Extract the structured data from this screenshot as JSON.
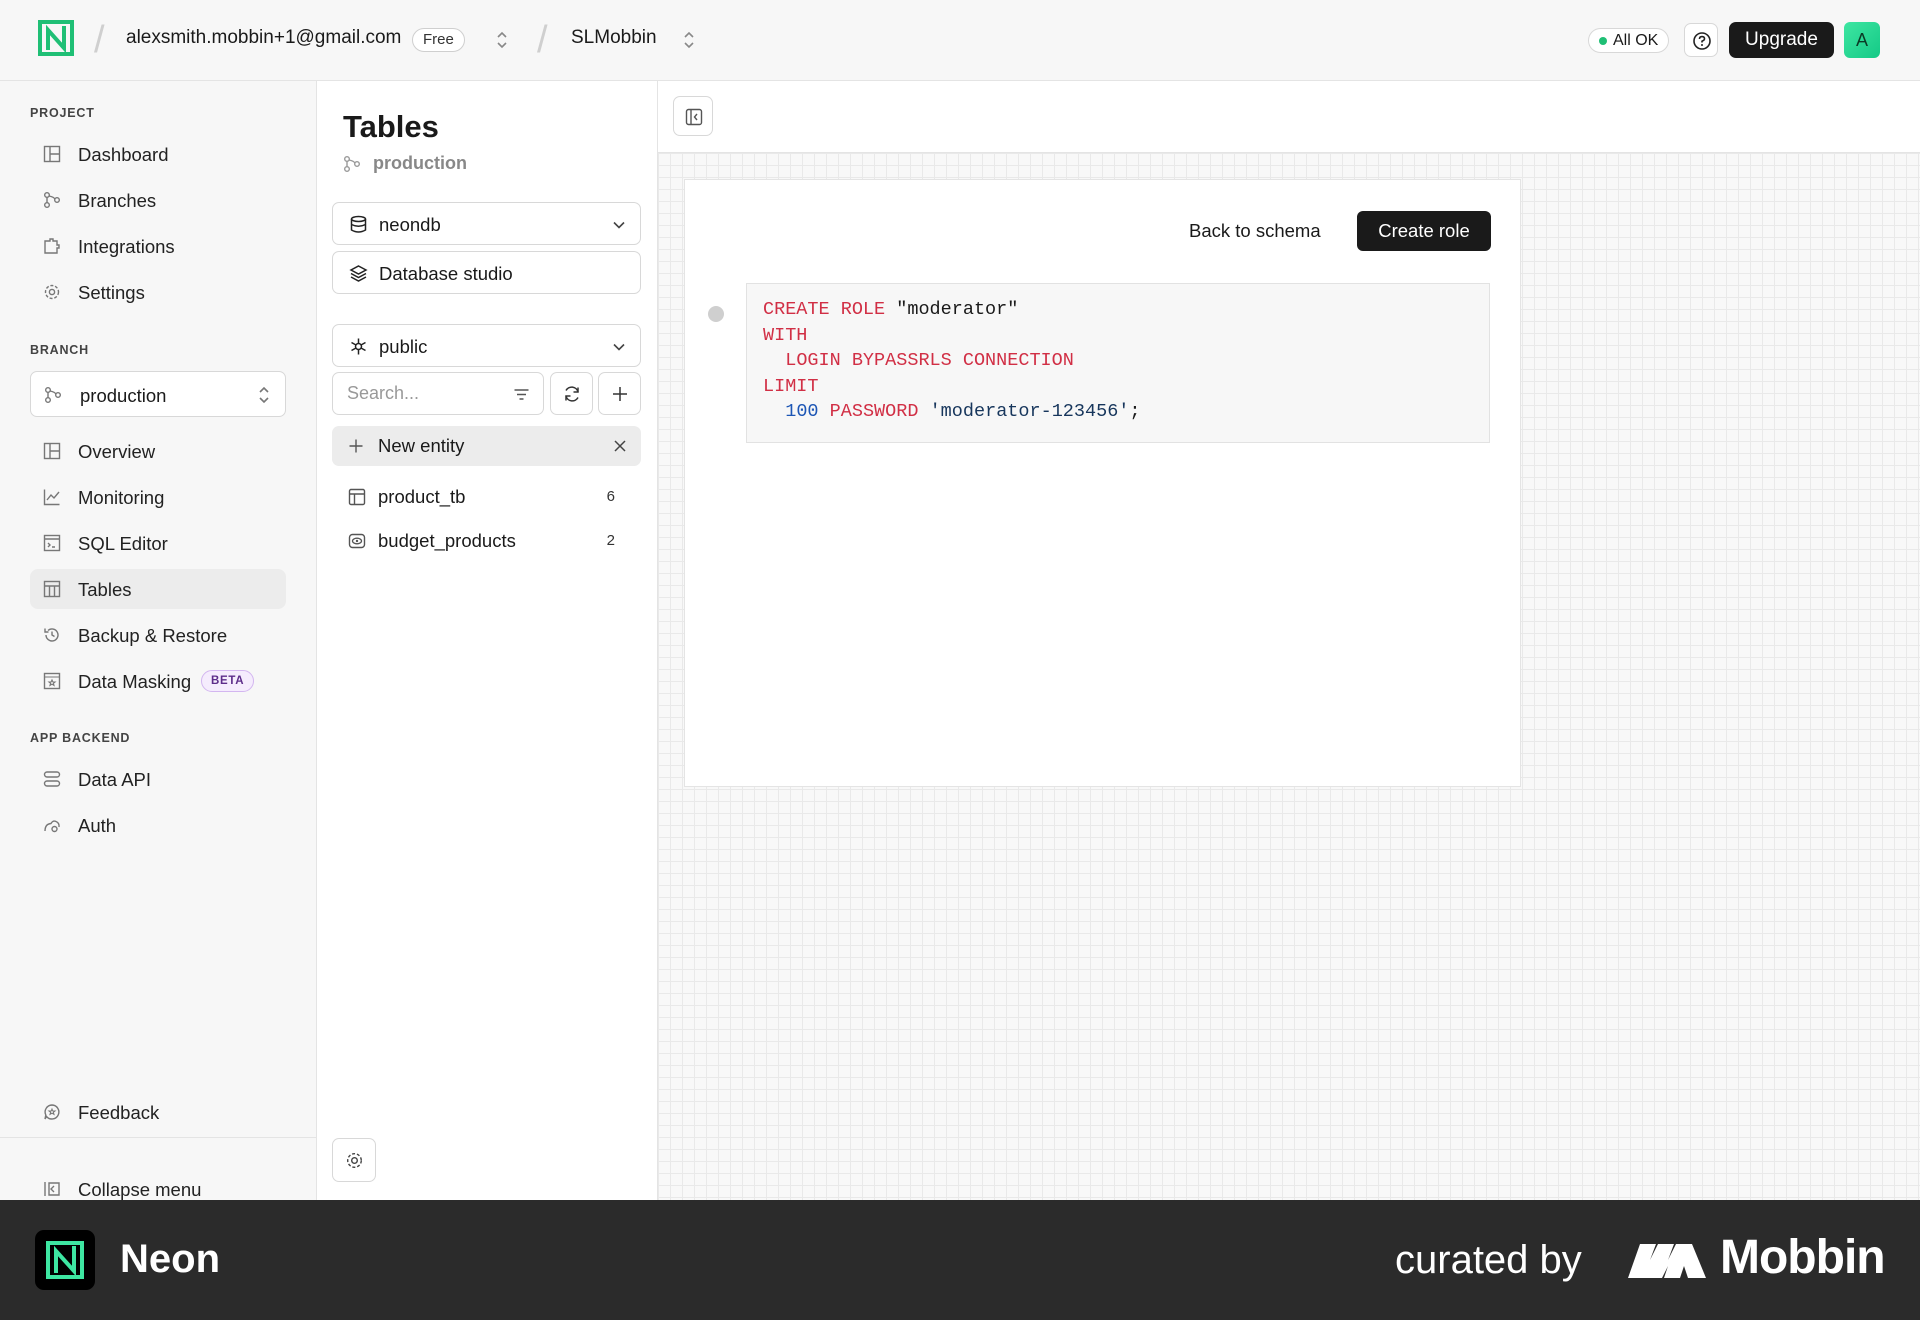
{
  "topbar": {
    "account": "alexsmith.mobbin+1@gmail.com",
    "plan": "Free",
    "project": "SLMobbin",
    "status": "All OK",
    "upgrade": "Upgrade",
    "avatar": "A"
  },
  "sidebar": {
    "project_heading": "PROJECT",
    "project_items": [
      {
        "label": "Dashboard",
        "icon": "dashboard-icon"
      },
      {
        "label": "Branches",
        "icon": "branches-icon"
      },
      {
        "label": "Integrations",
        "icon": "integrations-icon"
      },
      {
        "label": "Settings",
        "icon": "settings-icon"
      }
    ],
    "branch_heading": "BRANCH",
    "branch_selected": "production",
    "branch_items": [
      {
        "label": "Overview",
        "icon": "overview-icon"
      },
      {
        "label": "Monitoring",
        "icon": "monitoring-icon"
      },
      {
        "label": "SQL Editor",
        "icon": "sql-editor-icon"
      },
      {
        "label": "Tables",
        "icon": "tables-icon",
        "active": true
      },
      {
        "label": "Backup & Restore",
        "icon": "backup-icon"
      },
      {
        "label": "Data Masking",
        "icon": "data-masking-icon",
        "badge": "BETA"
      }
    ],
    "backend_heading": "APP BACKEND",
    "backend_items": [
      {
        "label": "Data API",
        "icon": "data-api-icon"
      },
      {
        "label": "Auth",
        "icon": "auth-icon"
      }
    ],
    "feedback": "Feedback",
    "collapse": "Collapse menu"
  },
  "tables_panel": {
    "title": "Tables",
    "branch": "production",
    "database": "neondb",
    "studio": "Database studio",
    "schema": "public",
    "search_placeholder": "Search...",
    "new_entity": "New entity",
    "entities": [
      {
        "name": "product_tb",
        "count": "6",
        "icon": "table-icon"
      },
      {
        "name": "budget_products",
        "count": "2",
        "icon": "view-icon"
      }
    ]
  },
  "editor": {
    "back": "Back to schema",
    "create": "Create role",
    "sql": {
      "l1_kw": "CREATE ROLE",
      "l1_str": "\"moderator\"",
      "l2_kw": "WITH",
      "l3_kw": "LOGIN BYPASSRLS CONNECTION",
      "l4_kw": "LIMIT",
      "l5_num": "100",
      "l5_kw": "PASSWORD",
      "l5_str": "'moderator-123456'",
      "l5_end": ";"
    }
  },
  "footer": {
    "brand": "Neon",
    "curated": "curated by",
    "mobbin": "Mobbin"
  },
  "colors": {
    "accent": "#1fbf75",
    "neon_green": "#3ee6a2",
    "dark": "#1a1a1a",
    "sql_keyword": "#d12f45",
    "sql_number": "#1d56b5",
    "footer_bg": "#2b2b2b"
  }
}
